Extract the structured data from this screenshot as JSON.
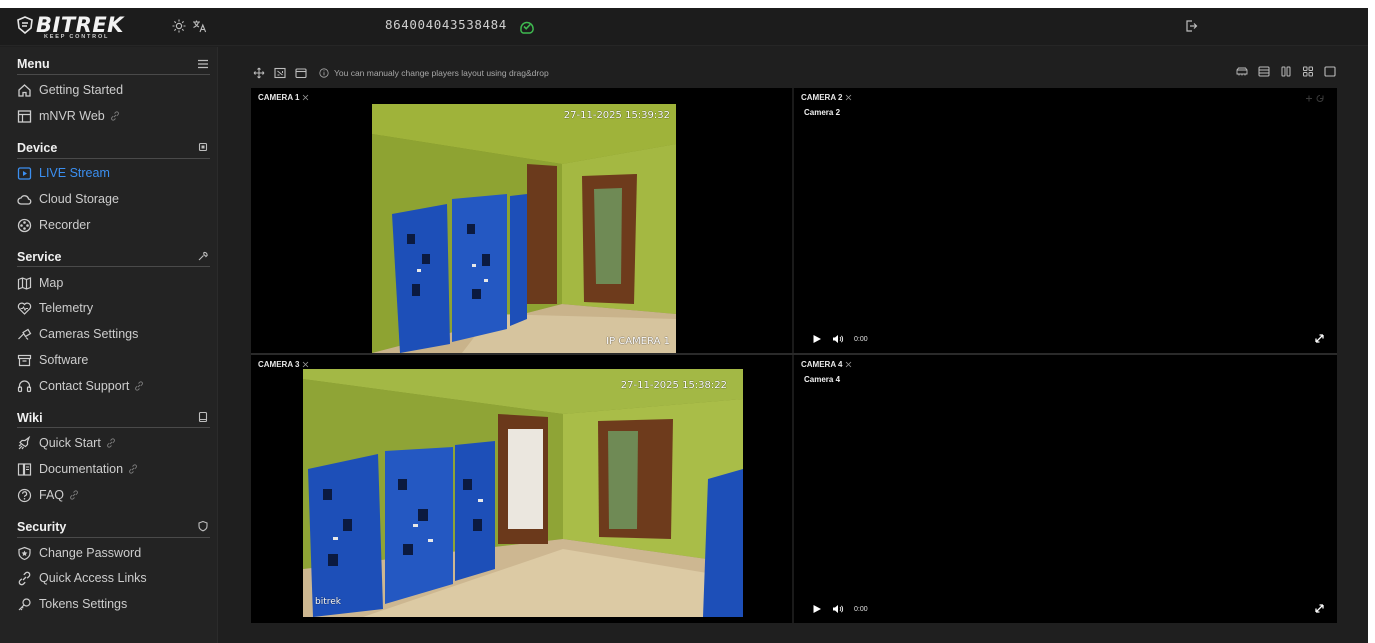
{
  "header": {
    "logo_text": "BITREK",
    "logo_tagline": "KEEP CONTROL",
    "device_id": "864004043538484",
    "theme_icon": "sun-icon",
    "language_icon": "translate-icon",
    "status_icon": "online-check-icon",
    "logout_icon": "logout-icon"
  },
  "sidebar": {
    "sections": {
      "menu": {
        "title": "Menu",
        "icon": "hamburger-icon"
      },
      "device": {
        "title": "Device",
        "icon": "chip-icon"
      },
      "service": {
        "title": "Service",
        "icon": "wrench-icon"
      },
      "wiki": {
        "title": "Wiki",
        "icon": "book-icon"
      },
      "security": {
        "title": "Security",
        "icon": "shield-icon"
      }
    },
    "items": {
      "getting_started": "Getting Started",
      "mnvr_web": "mNVR Web",
      "live_stream": "LIVE Stream",
      "cloud_storage": "Cloud Storage",
      "recorder": "Recorder",
      "map": "Map",
      "telemetry": "Telemetry",
      "cameras_settings": "Cameras Settings",
      "software": "Software",
      "contact_support": "Contact Support",
      "quick_start": "Quick Start",
      "documentation": "Documentation",
      "faq": "FAQ",
      "change_password": "Change Password",
      "quick_access_links": "Quick Access Links",
      "tokens_settings": "Tokens Settings"
    },
    "active_item": "LIVE Stream",
    "accent_color": "#3b8ff0"
  },
  "toolbar": {
    "hint": "You can manualy change players layout using drag&drop",
    "icons": [
      "move-icon",
      "expand-icon",
      "window-icon"
    ],
    "layout_icons": [
      "layout-wide-icon",
      "layout-rows-icon",
      "layout-columns-icon",
      "layout-grid-icon",
      "layout-single-icon"
    ]
  },
  "cameras": [
    {
      "title": "CAMERA 1",
      "osd_time": "27-11-2025 15:39:32",
      "osd_label": "IP CAMERA 1"
    },
    {
      "title": "CAMERA 2",
      "name": "Camera 2",
      "time": "0:00"
    },
    {
      "title": "CAMERA 3",
      "osd_time": "27-11-2025 15:38:22",
      "osd_label": "bitrek"
    },
    {
      "title": "CAMERA 4",
      "name": "Camera 4",
      "time": "0:00"
    }
  ]
}
